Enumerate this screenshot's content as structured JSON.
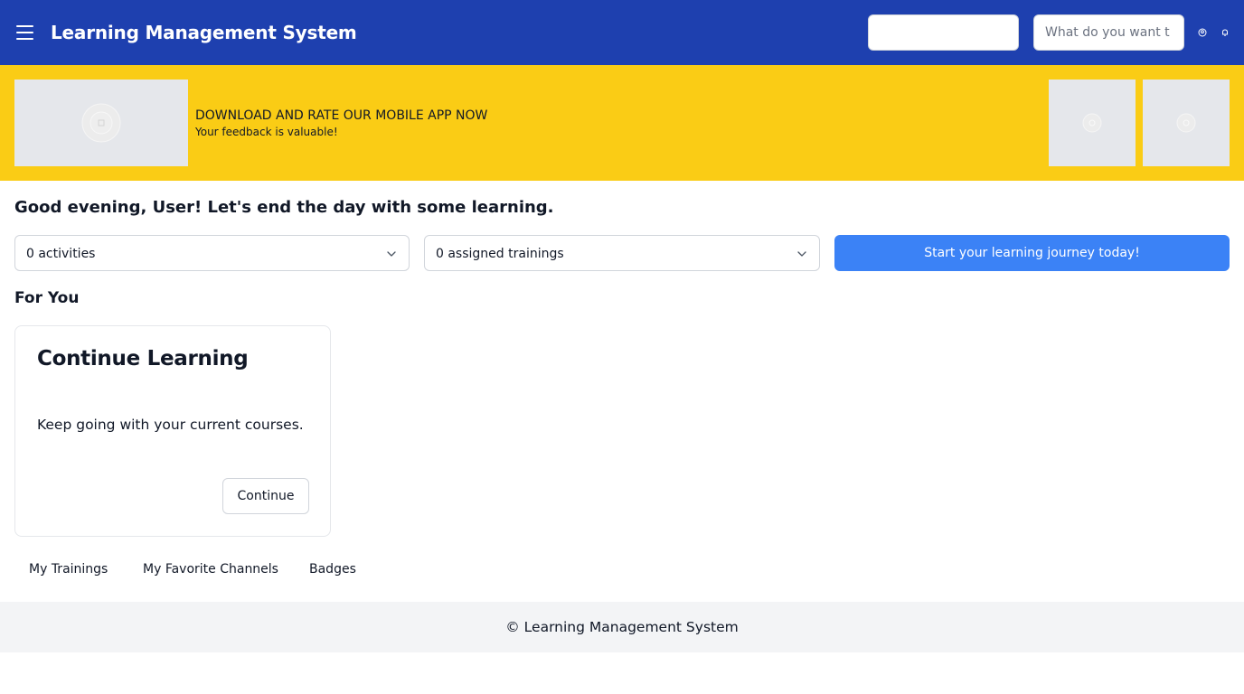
{
  "header": {
    "title": "Learning Management System",
    "search_placeholder": "What do you want t",
    "icons": [
      "user-icon",
      "bell-icon"
    ]
  },
  "banner": {
    "title": "DOWNLOAD AND RATE OUR MOBILE APP NOW",
    "subtitle": "Your feedback is valuable!"
  },
  "greeting": "Good evening, User! Let's end the day with some learning.",
  "filters": {
    "activities": "0 activities",
    "trainings": "0 assigned trainings"
  },
  "cta_label": "Start your learning journey today!",
  "for_you": {
    "title": "For You",
    "card": {
      "title": "Continue Learning",
      "description": "Keep going with your current courses.",
      "button_label": "Continue"
    }
  },
  "tabs": [
    {
      "label": "My Trainings"
    },
    {
      "label": "My Favorite Channels"
    },
    {
      "label": "Badges"
    }
  ],
  "footer": {
    "text": "© Learning Management System"
  },
  "colors": {
    "header": "#1e40af",
    "banner": "#facc15",
    "cta": "#3b82f6",
    "footer": "#f3f4f6"
  }
}
